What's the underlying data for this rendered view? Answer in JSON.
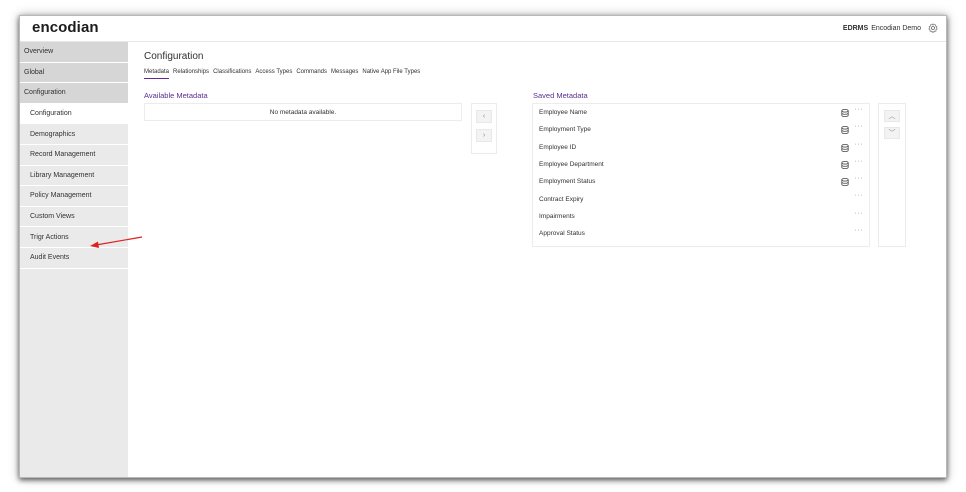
{
  "header": {
    "logo": "encodian",
    "org": "EDRMS",
    "user": "Encodian Demo",
    "settings_icon": "gear-icon"
  },
  "sidebar": {
    "items": [
      {
        "label": "Overview",
        "level": "top"
      },
      {
        "label": "Global",
        "level": "top"
      },
      {
        "label": "Configuration",
        "level": "top"
      },
      {
        "label": "Configuration",
        "level": "sub",
        "active": true
      },
      {
        "label": "Demographics",
        "level": "sub"
      },
      {
        "label": "Record Management",
        "level": "sub"
      },
      {
        "label": "Library Management",
        "level": "sub"
      },
      {
        "label": "Policy Management",
        "level": "sub"
      },
      {
        "label": "Custom Views",
        "level": "sub"
      },
      {
        "label": "Trigr Actions",
        "level": "sub"
      },
      {
        "label": "Audit Events",
        "level": "sub"
      }
    ]
  },
  "main": {
    "title": "Configuration",
    "tabs": [
      {
        "label": "Metadata",
        "active": true
      },
      {
        "label": "Relationships"
      },
      {
        "label": "Classifications"
      },
      {
        "label": "Access Types"
      },
      {
        "label": "Commands"
      },
      {
        "label": "Messages"
      },
      {
        "label": "Native App File Types"
      }
    ],
    "available": {
      "label": "Available Metadata",
      "empty_text": "No metadata available."
    },
    "move_buttons": {
      "left": "‹",
      "right": "›"
    },
    "saved": {
      "label": "Saved Metadata",
      "items": [
        {
          "label": "Employee Name",
          "icon": "database-icon"
        },
        {
          "label": "Employment Type",
          "icon": "database-icon"
        },
        {
          "label": "Employee ID",
          "icon": "database-icon"
        },
        {
          "label": "Employee Department",
          "icon": "database-icon"
        },
        {
          "label": "Employment Status",
          "icon": "database-icon"
        },
        {
          "label": "Contract Expiry"
        },
        {
          "label": "Impairments"
        },
        {
          "label": "Approval Status"
        }
      ],
      "more_glyph": "···"
    },
    "order_buttons": {
      "up": "︿",
      "down": "﹀"
    }
  },
  "colors": {
    "accent": "#5c2d91",
    "sidebar_bg": "#eaeaea",
    "sidebar_top_bg": "#d6d6d6",
    "annotation": "#e02020"
  }
}
